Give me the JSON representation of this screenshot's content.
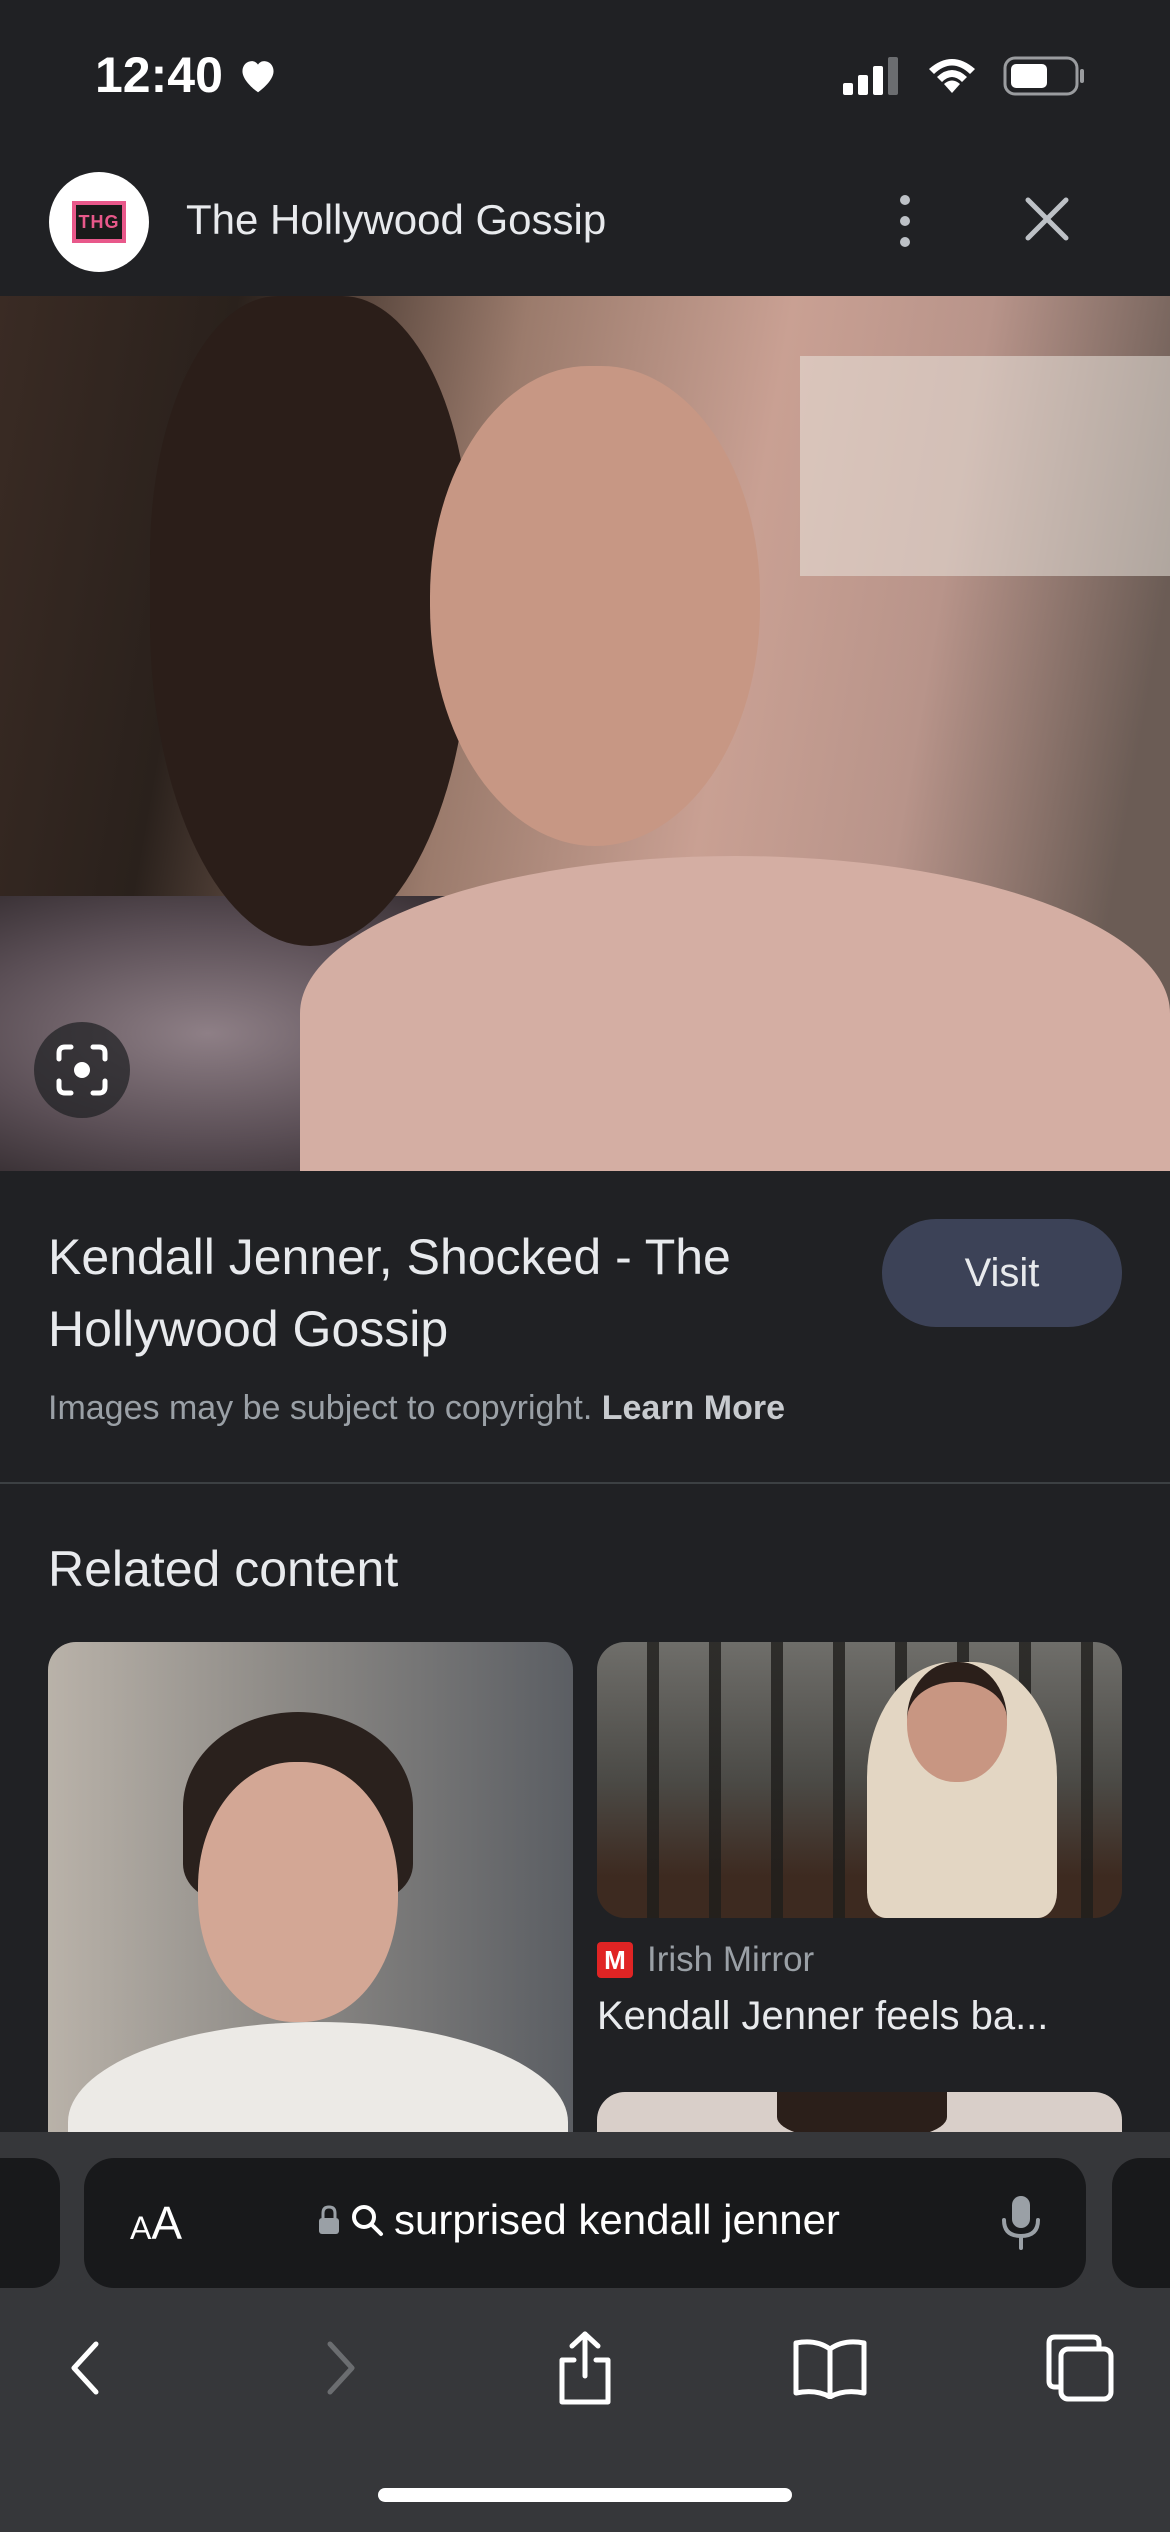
{
  "status_bar": {
    "time": "12:40"
  },
  "header": {
    "logo_text": "THG",
    "site_name": "The Hollywood Gossip"
  },
  "result": {
    "title": "Kendall Jenner, Shocked - The Hollywood Gossip",
    "visit_label": "Visit",
    "copyright_text": "Images may be subject to copyright.",
    "learn_more_label": "Learn More"
  },
  "related": {
    "heading": "Related content",
    "items": [
      {
        "source": "Irish Mirror",
        "source_icon_letter": "M",
        "title": "Kendall Jenner feels ba..."
      }
    ]
  },
  "address_bar": {
    "aa_label_small": "A",
    "aa_label_large": "A",
    "query": "surprised kendall jenner"
  },
  "colors": {
    "background": "#202124",
    "visit_button": "#3c4257",
    "toolbar": "#36373a",
    "source_icon": "#e02424",
    "logo_accent": "#e8588a"
  }
}
